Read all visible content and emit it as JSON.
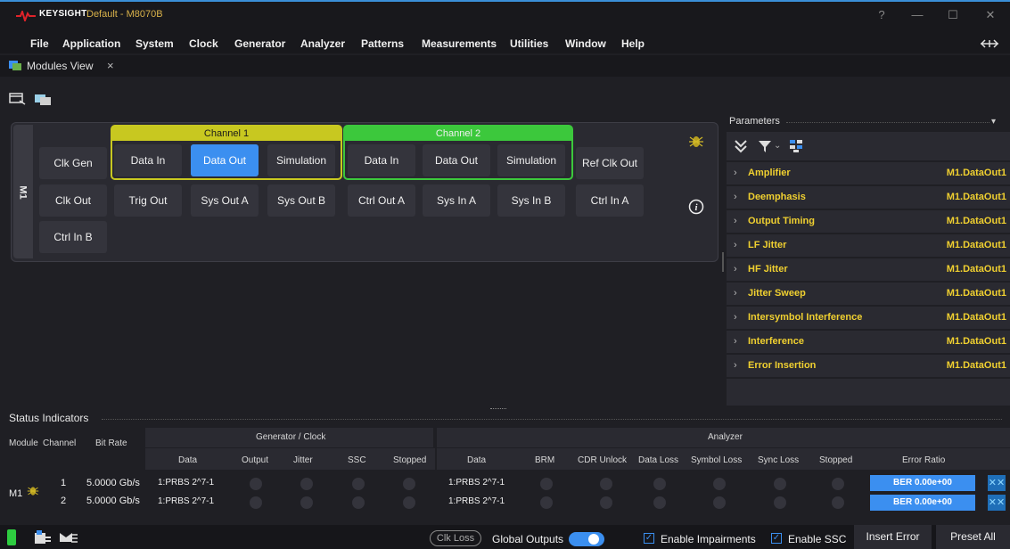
{
  "app": {
    "brand": "KEYSIGHT",
    "document": "Default - M8070B",
    "accent": "#3b8ff0",
    "window_controls": [
      "?",
      "—",
      "☐",
      "✕"
    ]
  },
  "menubar": {
    "items": [
      "File",
      "Application",
      "System",
      "Clock",
      "Generator",
      "Analyzer",
      "Patterns",
      "Measurements",
      "Utilities",
      "Window",
      "Help"
    ],
    "pin_icon": "pin-icon"
  },
  "tab": {
    "label": "Modules View",
    "close": "×"
  },
  "modules": {
    "module_label": "M1",
    "channel1": "Channel 1",
    "channel2": "Channel 2",
    "row1": {
      "clk_gen": "Clk Gen",
      "ch1_data_in": "Data In",
      "ch1_data_out": "Data Out",
      "ch1_simulation": "Simulation",
      "ch2_data_in": "Data In",
      "ch2_data_out": "Data Out",
      "ch2_simulation": "Simulation",
      "ref_clk_out": "Ref Clk Out"
    },
    "row2": [
      "Clk Out",
      "Trig Out",
      "Sys Out A",
      "Sys Out B",
      "Ctrl Out A",
      "Sys In A",
      "Sys In B",
      "Ctrl In A"
    ],
    "row3": [
      "Ctrl In B"
    ],
    "info_icon": "i"
  },
  "parameters": {
    "title": "Parameters",
    "rows": [
      {
        "name": "Amplifier",
        "value": "M1.DataOut1"
      },
      {
        "name": "Deemphasis",
        "value": "M1.DataOut1"
      },
      {
        "name": "Output Timing",
        "value": "M1.DataOut1"
      },
      {
        "name": "LF Jitter",
        "value": "M1.DataOut1"
      },
      {
        "name": "HF Jitter",
        "value": "M1.DataOut1"
      },
      {
        "name": "Jitter Sweep",
        "value": "M1.DataOut1"
      },
      {
        "name": "Intersymbol Interference",
        "value": "M1.DataOut1"
      },
      {
        "name": "Interference",
        "value": "M1.DataOut1"
      },
      {
        "name": "Error Insertion",
        "value": "M1.DataOut1"
      }
    ]
  },
  "status": {
    "title": "Status Indicators",
    "headers": {
      "module": "Module",
      "channel": "Channel",
      "bit_rate": "Bit Rate",
      "generator_group": "Generator / Clock",
      "analyzer_group": "Analyzer",
      "gen_cols": [
        "Data",
        "Output",
        "Jitter",
        "SSC",
        "Stopped"
      ],
      "ana_cols": [
        "Data",
        "BRM",
        "CDR Unlock",
        "Data Loss",
        "Symbol Loss",
        "Sync Loss",
        "Stopped",
        "Error Ratio"
      ]
    },
    "module_name": "M1",
    "rows": [
      {
        "channel": "1",
        "bit_rate": "5.0000 Gb/s",
        "gen_data": "1:PRBS 2^7-1",
        "ana_data": "1:PRBS 2^7-1",
        "ber": "BER 0.00e+00"
      },
      {
        "channel": "2",
        "bit_rate": "5.0000 Gb/s",
        "gen_data": "1:PRBS 2^7-1",
        "ana_data": "1:PRBS 2^7-1",
        "ber": "BER 0.00e+00"
      }
    ]
  },
  "bottom": {
    "clk_loss": "Clk Loss",
    "global_outputs": "Global Outputs",
    "enable_impairments": "Enable Impairments",
    "enable_ssc": "Enable SSC",
    "insert_error": "Insert Error",
    "preset_all": "Preset All"
  }
}
